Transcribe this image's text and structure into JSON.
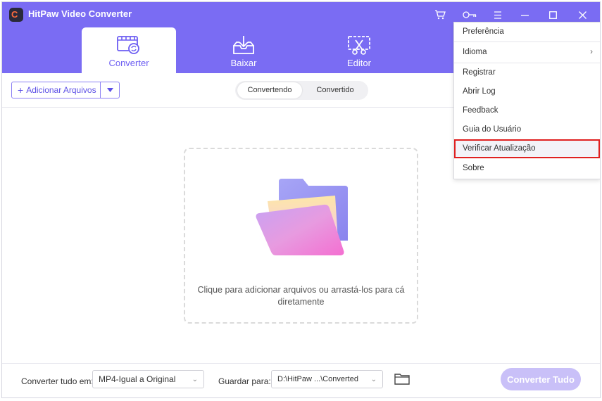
{
  "app": {
    "title": "HitPaw Video Converter"
  },
  "tabs": [
    {
      "label": "Converter",
      "icon": "film-convert-icon",
      "active": true
    },
    {
      "label": "Baixar",
      "icon": "download-tray-icon",
      "active": false
    },
    {
      "label": "Editor",
      "icon": "scissors-edit-icon",
      "active": false
    }
  ],
  "toolbar": {
    "add_files_label": "Adicionar Arquivos",
    "segments": [
      "Convertendo",
      "Convertido"
    ]
  },
  "drop_zone": {
    "text_line1": "Clique para adicionar arquivos ou arrastá-los para cá",
    "text_line2": "diretamente"
  },
  "footer": {
    "convert_all_to_label": "Converter tudo em:",
    "format_value": "MP4-Igual a Original",
    "save_to_label": "Guardar para:",
    "path_value": "D:\\HitPaw ...\\Converted",
    "convert_all_button": "Converter Tudo"
  },
  "menu": {
    "items": [
      {
        "label": "Preferência"
      },
      {
        "label": "Idioma",
        "submenu": true
      },
      {
        "label": "Registrar"
      },
      {
        "label": "Abrir Log"
      },
      {
        "label": "Feedback"
      },
      {
        "label": "Guia do Usuário"
      },
      {
        "label": "Verificar Atualização",
        "highlighted": true
      },
      {
        "label": "Sobre"
      }
    ]
  },
  "colors": {
    "header": "#7a6cf3",
    "accent": "#5d50e6",
    "highlight_border": "#e02020",
    "convert_button": "#c9c0f8"
  }
}
